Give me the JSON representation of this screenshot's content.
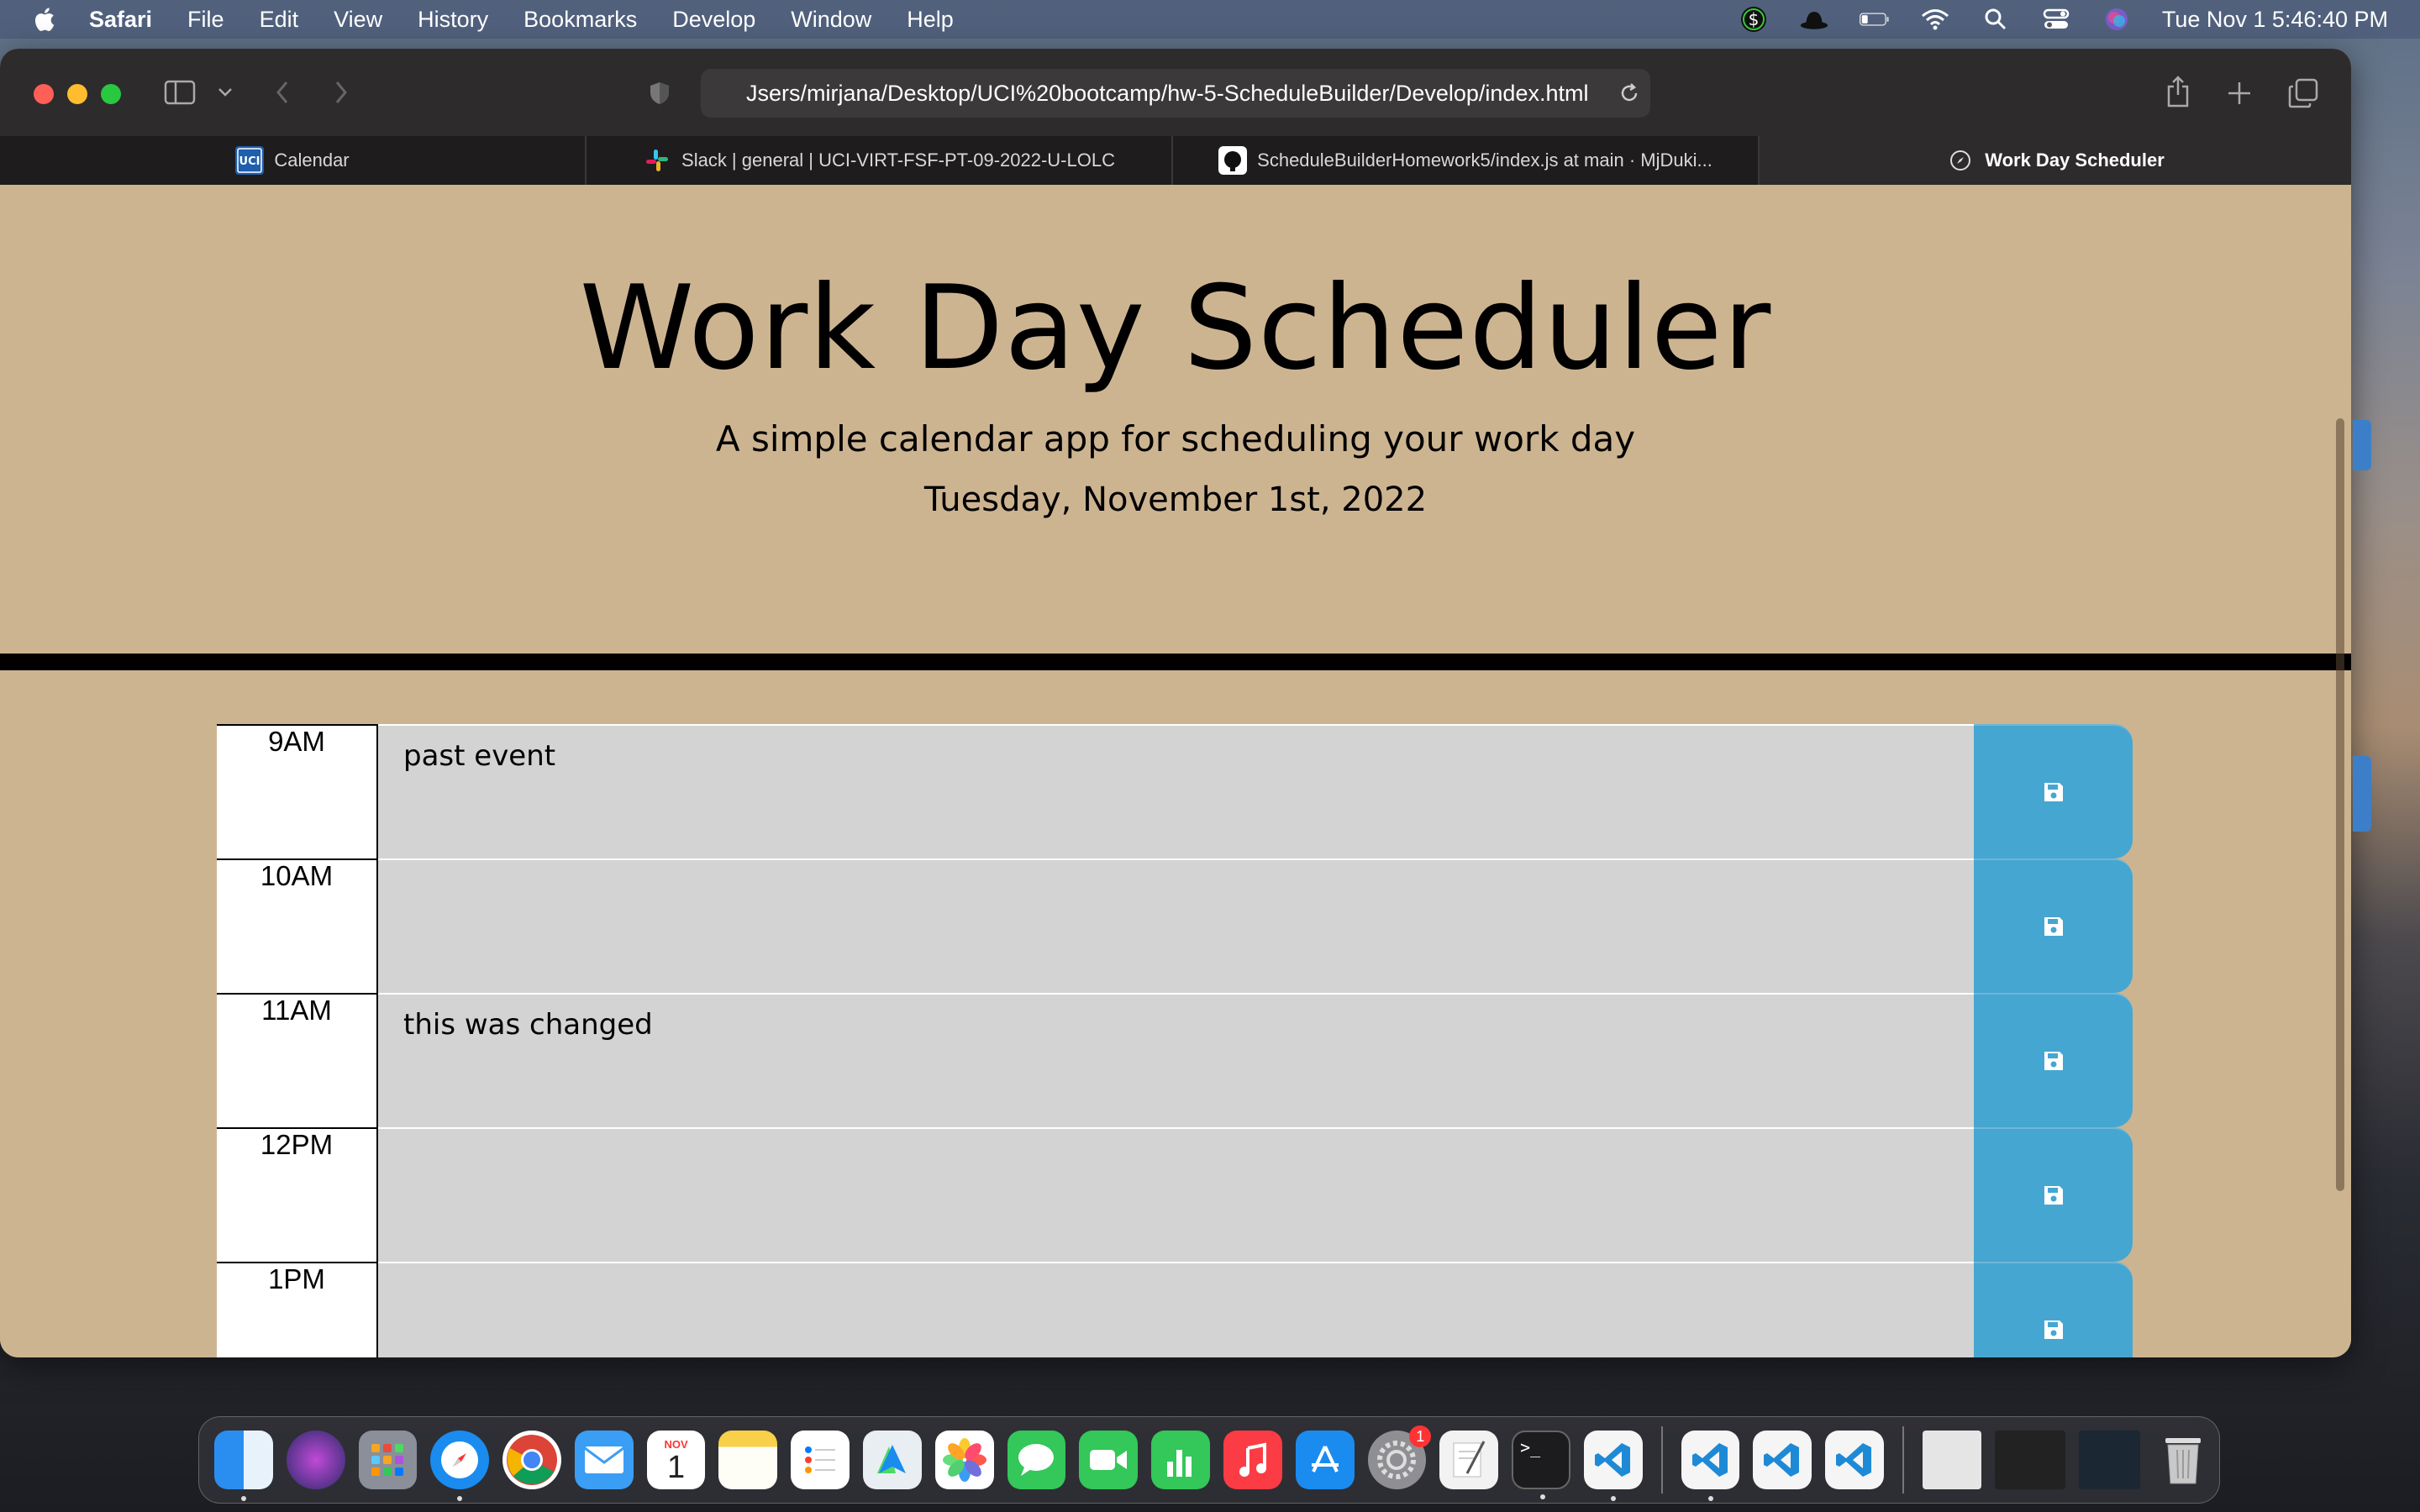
{
  "menubar": {
    "app_name": "Safari",
    "menus": [
      "File",
      "Edit",
      "View",
      "History",
      "Bookmarks",
      "Develop",
      "Window",
      "Help"
    ],
    "clock": "Tue Nov 1  5:46:40 PM"
  },
  "browser": {
    "address": "Jsers/mirjana/Desktop/UCI%20bootcamp/hw-5-ScheduleBuilder/Develop/index.html",
    "tabs": [
      {
        "label": "Calendar",
        "icon": "uci-icon"
      },
      {
        "label": "Slack | general | UCI-VIRT-FSF-PT-09-2022-U-LOLC",
        "icon": "slack-icon"
      },
      {
        "label": "ScheduleBuilderHomework5/index.js at main · MjDuki...",
        "icon": "github-icon"
      },
      {
        "label": "Work Day Scheduler",
        "icon": "compass-icon",
        "active": true
      }
    ]
  },
  "page": {
    "title": "Work Day Scheduler",
    "lead": "A simple calendar app for scheduling your work day",
    "current_day": "Tuesday, November 1st, 2022"
  },
  "schedule": [
    {
      "hour": "9AM",
      "text": "past event"
    },
    {
      "hour": "10AM",
      "text": ""
    },
    {
      "hour": "11AM",
      "text": "this was changed"
    },
    {
      "hour": "12PM",
      "text": ""
    },
    {
      "hour": "1PM",
      "text": ""
    }
  ],
  "dock": {
    "calendar_month": "NOV",
    "calendar_day": "1",
    "settings_badge": "1"
  },
  "colors": {
    "page_bg": "#cdb491",
    "save_button": "#45a7d1",
    "row_bg": "#d3d3d3"
  }
}
